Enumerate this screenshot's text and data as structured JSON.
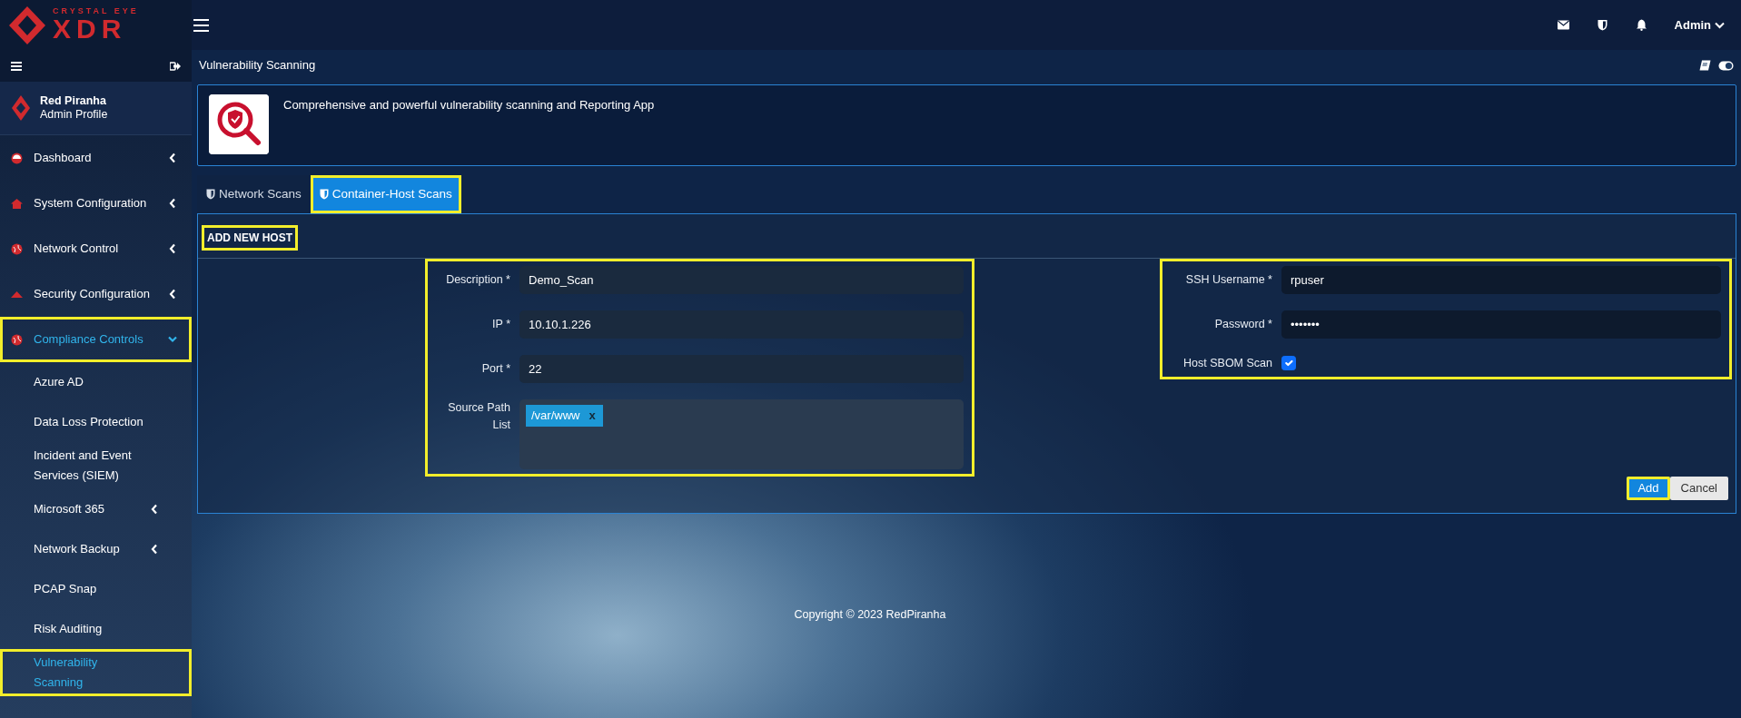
{
  "logo": {
    "tagline": "CRYSTAL EYE",
    "wordmark": "XDR"
  },
  "header": {
    "user": "Admin"
  },
  "profile": {
    "name": "Red Piranha",
    "role": "Admin Profile"
  },
  "sidebar": {
    "items": [
      {
        "label": "Dashboard",
        "selected": false,
        "highlighted": false,
        "expanded": false
      },
      {
        "label": "System Configuration",
        "selected": false,
        "highlighted": false,
        "expanded": false
      },
      {
        "label": "Network Control",
        "selected": false,
        "highlighted": false,
        "expanded": false
      },
      {
        "label": "Security Configuration",
        "selected": false,
        "highlighted": false,
        "expanded": false
      },
      {
        "label": "Compliance Controls",
        "selected": true,
        "highlighted": true,
        "expanded": true,
        "children": [
          {
            "label": "Azure AD",
            "kind": "link",
            "selected": false,
            "highlighted": false
          },
          {
            "label": "Data Loss Protection",
            "kind": "link",
            "selected": false,
            "highlighted": false
          },
          {
            "label": "Incident and Event Services (SIEM)",
            "kind": "link",
            "selected": false,
            "highlighted": false
          },
          {
            "label": "Microsoft 365",
            "kind": "submenu",
            "selected": false,
            "highlighted": false
          },
          {
            "label": "Network Backup",
            "kind": "submenu",
            "selected": false,
            "highlighted": false
          },
          {
            "label": "PCAP Snap",
            "kind": "link",
            "selected": false,
            "highlighted": false
          },
          {
            "label": "Risk Auditing",
            "kind": "link",
            "selected": false,
            "highlighted": false
          },
          {
            "label": "Vulnerability Scanning",
            "kind": "link",
            "selected": true,
            "highlighted": true
          }
        ]
      }
    ]
  },
  "page_title": "Vulnerability Scanning",
  "app": {
    "description": "Comprehensive and powerful vulnerability scanning and Reporting App"
  },
  "tabs": [
    {
      "label": "Network Scans",
      "selected": false,
      "highlighted": false
    },
    {
      "label": "Container-Host Scans",
      "selected": true,
      "highlighted": true
    }
  ],
  "form": {
    "title": "ADD NEW HOST",
    "title_highlighted": true,
    "left_group": {
      "highlighted": true,
      "fields": [
        {
          "kind": "text",
          "label": "Description *",
          "value": "Demo_Scan"
        },
        {
          "kind": "text",
          "label": "IP *",
          "value": "10.10.1.226"
        },
        {
          "kind": "text",
          "label": "Port *",
          "value": "22"
        },
        {
          "kind": "tags",
          "label": "Source Path List",
          "tags": [
            {
              "text": "/var/www",
              "remove": "x"
            }
          ]
        }
      ]
    },
    "right_group": {
      "highlighted": true,
      "fields": [
        {
          "kind": "text",
          "label": "SSH Username *",
          "value": "rpuser"
        },
        {
          "kind": "text",
          "label": "Password *",
          "value": "•••••••"
        },
        {
          "kind": "checkbox",
          "label": "Host SBOM Scan",
          "checked": true
        }
      ]
    },
    "buttons": [
      {
        "label": "Add",
        "kind": "primary",
        "highlighted": true
      },
      {
        "label": "Cancel",
        "kind": "secondary",
        "highlighted": false
      }
    ]
  },
  "footer": "Copyright © 2023 RedPiranha"
}
